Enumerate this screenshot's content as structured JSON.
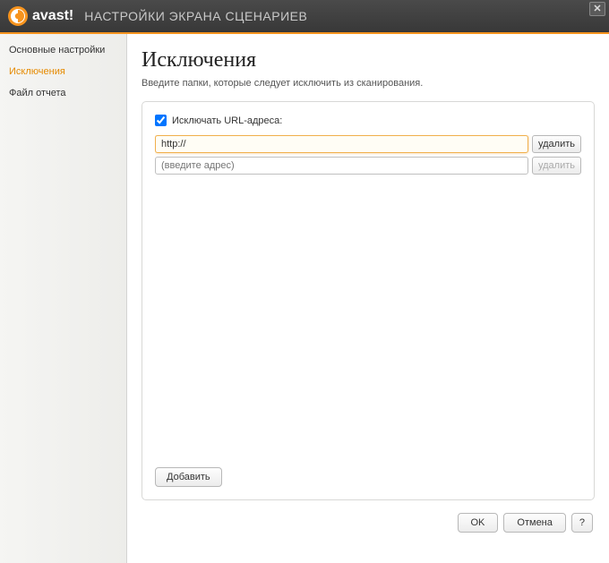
{
  "window": {
    "app_name": "avast!",
    "title": "НАСТРОЙКИ ЭКРАНА СЦЕНАРИЕВ",
    "close_glyph": "✕"
  },
  "sidebar": {
    "items": [
      {
        "label": "Основные настройки"
      },
      {
        "label": "Исключения"
      },
      {
        "label": "Файл отчета"
      }
    ],
    "active_index": 1
  },
  "main": {
    "heading": "Исключения",
    "subtitle": "Введите папки, которые следует исключить из сканирования.",
    "exclude_checkbox_label": "Исключать URL-адреса:",
    "exclude_checked": true,
    "rows": [
      {
        "value": "http://",
        "delete_label": "удалить",
        "delete_enabled": true,
        "active": true
      },
      {
        "value": "",
        "placeholder": "(введите адрес)",
        "delete_label": "удалить",
        "delete_enabled": false,
        "active": false
      }
    ],
    "add_button": "Добавить"
  },
  "footer": {
    "ok": "OK",
    "cancel": "Отмена",
    "help": "?"
  },
  "colors": {
    "accent": "#f7941e"
  }
}
